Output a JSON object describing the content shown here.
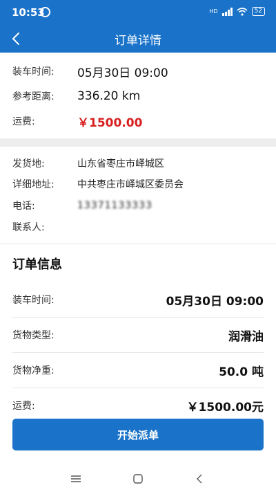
{
  "status_bar": {
    "time": "10:53",
    "network": "HD",
    "battery": "52"
  },
  "nav": {
    "title": "订单详情"
  },
  "summary": {
    "load_time_label": "装车时间:",
    "load_time_value": "05月30日 09:00",
    "distance_label": "参考距离:",
    "distance_value": "336.20 km",
    "freight_label": "运费:",
    "freight_value": "￥1500.00"
  },
  "shipper": {
    "origin_label": "发货地:",
    "origin_value": "山东省枣庄市峄城区",
    "detail_label": "详细地址:",
    "detail_value": "中共枣庄市峄城区委员会",
    "phone_label": "电话:",
    "phone_value": "13371133333",
    "contact_label": "联系人:",
    "contact_value": ""
  },
  "order_info": {
    "title": "订单信息",
    "rows": [
      {
        "label": "装车时间:",
        "value": "05月30日 09:00"
      },
      {
        "label": "货物类型:",
        "value": "润滑油"
      },
      {
        "label": "货物净重:",
        "value": "50.0 吨"
      },
      {
        "label": "运费:",
        "value": "￥1500.00元"
      }
    ]
  },
  "footer": {
    "dispatch_button": "开始派单"
  },
  "colors": {
    "primary": "#1a73c9",
    "price": "#d81e1e"
  },
  "icons": {
    "back": "chevron-left-icon",
    "menu": "menu-icon",
    "home": "home-icon",
    "sys_back": "back-triangle-icon"
  }
}
